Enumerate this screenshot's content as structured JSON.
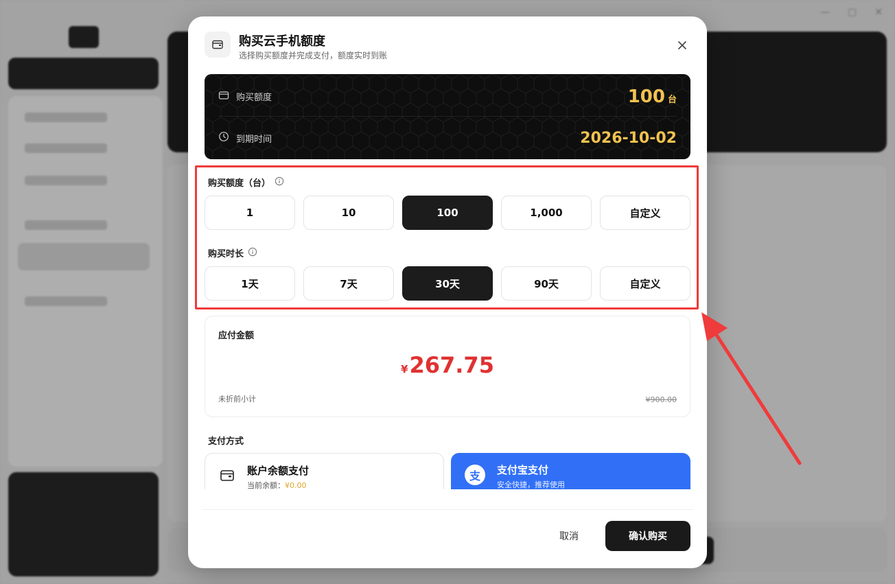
{
  "modal": {
    "title": "购买云手机额度",
    "subtitle": "选择购买额度并完成支付，额度实时到账",
    "summary": {
      "quota_label": "购买额度",
      "quota_value": "100",
      "quota_unit": "台",
      "expiry_label": "到期时间",
      "expiry_value": "2026-10-02"
    },
    "quota_section": {
      "label": "购买额度（台）",
      "options": [
        "1",
        "10",
        "100",
        "1,000",
        "自定义"
      ],
      "selected": "100"
    },
    "duration_section": {
      "label": "购买时长",
      "options": [
        "1天",
        "7天",
        "30天",
        "90天",
        "自定义"
      ],
      "selected": "30天"
    },
    "amount": {
      "label": "应付金额",
      "currency": "¥",
      "value": "267.75",
      "subtotal_label": "未折前小计",
      "subtotal_value": "¥900.00"
    },
    "payment": {
      "label": "支付方式",
      "balance": {
        "title": "账户余额支付",
        "sub_prefix": "当前余额：",
        "sub_amount": "¥0.00"
      },
      "alipay": {
        "title": "支付宝支付",
        "sub": "安全快捷，推荐使用",
        "logo_char": "支"
      }
    },
    "buttons": {
      "cancel": "取消",
      "confirm": "确认购买"
    }
  },
  "colors": {
    "accent_gold": "#f2c250",
    "price_red": "#e03131",
    "alipay_blue": "#3170f6",
    "highlight_red": "#ef3b3b",
    "selected_dark": "#1c1c1c"
  },
  "icons": [
    "wallet-icon",
    "close-icon",
    "clock-icon",
    "info-icon",
    "alipay-icon"
  ]
}
